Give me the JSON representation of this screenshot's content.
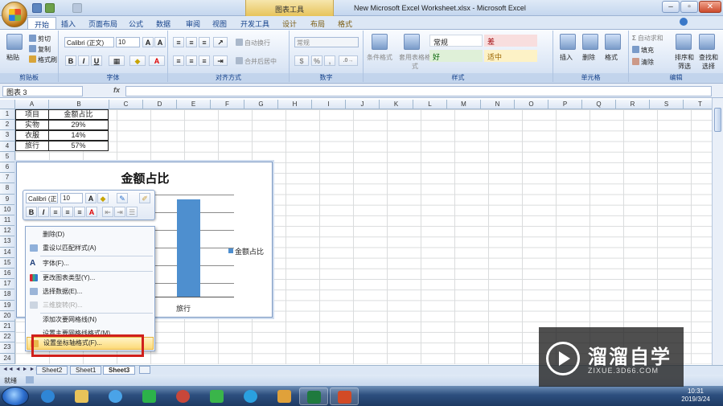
{
  "window": {
    "title": "New Microsoft Excel Worksheet.xlsx - Microsoft Excel",
    "tool_context": "图表工具"
  },
  "tabs": [
    "开始",
    "插入",
    "页面布局",
    "公式",
    "数据",
    "审阅",
    "视图",
    "开发工具",
    "设计",
    "布局",
    "格式"
  ],
  "ribbon": {
    "clipboard": {
      "label": "剪贴板",
      "paste": "粘贴",
      "cut": "剪切",
      "copy": "复制",
      "format_painter": "格式刷"
    },
    "font": {
      "label": "字体",
      "name": "Calibri (正文)",
      "size": "10",
      "bold": "B",
      "italic": "I",
      "underline": "U"
    },
    "alignment": {
      "label": "对齐方式",
      "wrap": "自动换行",
      "merge": "合并后居中"
    },
    "number": {
      "label": "数字",
      "format": "常规",
      "percent": "%",
      "comma": ","
    },
    "styles": {
      "label": "样式",
      "conditional": "条件格式",
      "table": "套用表格格式",
      "normal": "常规",
      "bad": "差",
      "good": "好",
      "neutral": "适中"
    },
    "cells": {
      "label": "单元格",
      "insert": "插入",
      "delete": "删除",
      "format": "格式"
    },
    "editing": {
      "label": "编辑",
      "autosum": "自动求和",
      "fill": "填充",
      "clear": "清除",
      "sort": "排序和筛选",
      "find": "查找和选择"
    }
  },
  "formula_bar": {
    "name_box": "图表 3",
    "fx": "fx",
    "content": ""
  },
  "columns": [
    "A",
    "B",
    "C",
    "D",
    "E",
    "F",
    "G",
    "H",
    "I",
    "J",
    "K",
    "L",
    "M",
    "N",
    "O",
    "P",
    "Q",
    "R",
    "S",
    "T"
  ],
  "rows": [
    "1",
    "2",
    "3",
    "4",
    "5",
    "6",
    "7",
    "8",
    "9",
    "10",
    "11",
    "12",
    "13",
    "14",
    "15",
    "16",
    "17",
    "18",
    "19",
    "20",
    "21",
    "22",
    "23",
    "24"
  ],
  "table": {
    "headers": [
      "项目",
      "金额占比"
    ],
    "rows": [
      [
        "实物",
        "29%"
      ],
      [
        "衣服",
        "14%"
      ],
      [
        "旅行",
        "57%"
      ]
    ]
  },
  "chart_data": {
    "type": "bar",
    "title": "金额占比",
    "categories": [
      "旅行"
    ],
    "series": [
      {
        "name": "金额占比",
        "values": [
          57
        ]
      }
    ],
    "legend": "right",
    "grid": true,
    "color": "#4e8fcf"
  },
  "mini_toolbar": {
    "font": "Calibri (正",
    "size": "10",
    "bold": "B",
    "italic": "I"
  },
  "context_menu": [
    {
      "label": "删除(D)",
      "enabled": true
    },
    {
      "label": "重设以匹配样式(A)",
      "enabled": true
    },
    {
      "label": "字体(F)...",
      "enabled": true
    },
    {
      "label": "更改图表类型(Y)...",
      "enabled": true
    },
    {
      "label": "选择数据(E)...",
      "enabled": true
    },
    {
      "label": "三维旋转(R)...",
      "enabled": false
    },
    {
      "label": "添加次要网格线(N)",
      "enabled": true
    },
    {
      "label": "设置主要网格线格式(M)...",
      "enabled": true
    },
    {
      "label": "设置坐标轴格式(F)...",
      "enabled": true
    }
  ],
  "sheets": [
    "Sheet2",
    "Sheet1",
    "Sheet3"
  ],
  "status": "就绪",
  "clock": {
    "time": "10:31",
    "date": "2019/3/24"
  },
  "watermark": {
    "title": "溜溜自学",
    "sub": "ZIXUE.3D66.COM"
  }
}
